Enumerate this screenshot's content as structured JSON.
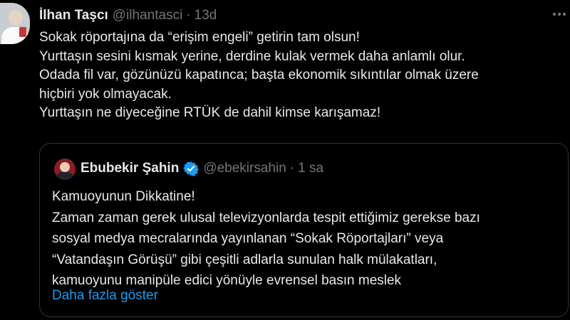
{
  "tweet": {
    "author_name": "İlhan Taşcı",
    "author_handle": "@ilhantasci",
    "separator": "·",
    "time": "13d",
    "lines": [
      "Sokak röportajına da “erişim engeli” getirin tam olsun!",
      "Yurttaşın sesini kısmak yerine, derdine kulak vermek daha anlamlı olur.",
      "Odada fil var, gözünüzü kapatınca; başta ekonomik sıkıntılar olmak üzere",
      "hiçbiri yok olmayacak.",
      "Yurttaşın ne diyeceğine RTÜK de dahil kimse karışamaz!"
    ],
    "more_icon": "more-horizontal-icon"
  },
  "quoted_tweet": {
    "author_name": "Ebubekir Şahin",
    "author_handle": "@ebekirsahin",
    "separator": "·",
    "time": "1 sa",
    "verified_icon": "verified-badge-icon",
    "lines": [
      "Kamuoyunun Dikkatine!",
      "Zaman zaman gerek ulusal televizyonlarda tespit ettiğimiz gerekse bazı",
      "sosyal medya mecralarında yayınlanan “Sokak Röportajları” veya",
      "“Vatandaşın Görüşü” gibi çeşitli adlarla sunulan halk mülakatları,",
      "kamuoyunu manipüle edici yönüyle evrensel basın meslek"
    ],
    "show_more": "Daha fazla göster"
  },
  "colors": {
    "background": "#000000",
    "text": "#e7e9ea",
    "muted": "#71767b",
    "link": "#1d9bf0",
    "border": "#2f3336"
  }
}
